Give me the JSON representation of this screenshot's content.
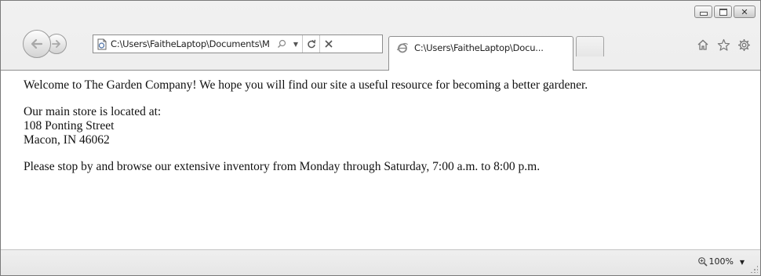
{
  "window": {
    "caption_buttons": [
      "minimize",
      "maximize",
      "close"
    ]
  },
  "navigation": {
    "back_icon": "back-arrow-icon",
    "forward_icon": "forward-arrow-icon"
  },
  "address_bar": {
    "url": "C:\\Users\\FaitheLaptop\\Documents\\M",
    "page_icon": "page-icon",
    "search_icon": "search-icon",
    "dropdown_icon": "chevron-down-icon",
    "refresh_icon": "refresh-icon",
    "stop_icon": "stop-icon"
  },
  "tabs": [
    {
      "title": "C:\\Users\\FaitheLaptop\\Docu...",
      "icon": "ie-page-icon",
      "active": true
    }
  ],
  "toolbar_right": {
    "icons": [
      "home-icon",
      "favorites-star-icon",
      "tools-gear-icon"
    ]
  },
  "content": {
    "paragraph1": "Welcome to The Garden Company! We hope you will find our site a useful resource for becoming a better gardener.",
    "address_lines": [
      "Our main store is located at:",
      "108 Ponting Street",
      "Macon, IN 46062"
    ],
    "paragraph3": "Please stop by and browse our extensive inventory from Monday through Saturday, 7:00 a.m. to 8:00 p.m."
  },
  "status_bar": {
    "zoom": "100%",
    "zoom_icon": "zoom-magnifier-icon"
  }
}
